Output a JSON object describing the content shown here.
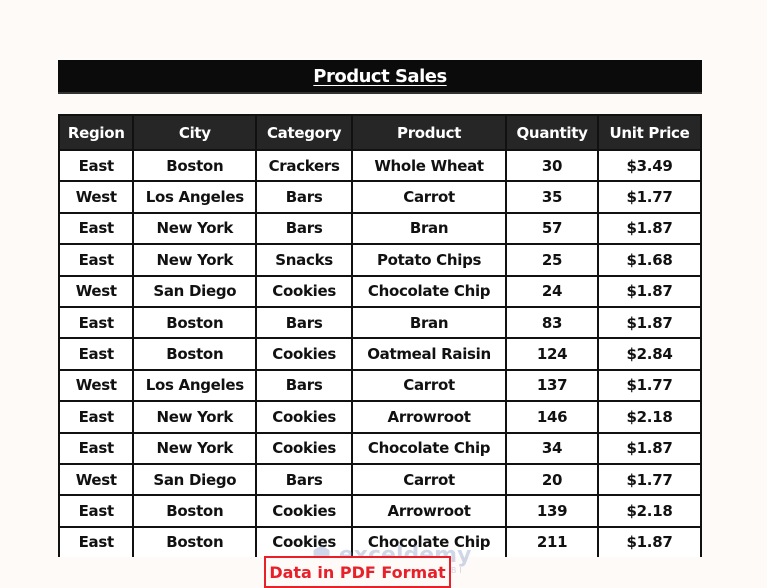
{
  "title": "Product Sales",
  "columns": [
    "Region",
    "City",
    "Category",
    "Product",
    "Quantity",
    "Unit Price"
  ],
  "rows": [
    [
      "East",
      "Boston",
      "Crackers",
      "Whole Wheat",
      "30",
      "$3.49"
    ],
    [
      "West",
      "Los Angeles",
      "Bars",
      "Carrot",
      "35",
      "$1.77"
    ],
    [
      "East",
      "New York",
      "Bars",
      "Bran",
      "57",
      "$1.87"
    ],
    [
      "East",
      "New York",
      "Snacks",
      "Potato Chips",
      "25",
      "$1.68"
    ],
    [
      "West",
      "San Diego",
      "Cookies",
      "Chocolate Chip",
      "24",
      "$1.87"
    ],
    [
      "East",
      "Boston",
      "Bars",
      "Bran",
      "83",
      "$1.87"
    ],
    [
      "East",
      "Boston",
      "Cookies",
      "Oatmeal Raisin",
      "124",
      "$2.84"
    ],
    [
      "West",
      "Los Angeles",
      "Bars",
      "Carrot",
      "137",
      "$1.77"
    ],
    [
      "East",
      "New York",
      "Cookies",
      "Arrowroot",
      "146",
      "$2.18"
    ],
    [
      "East",
      "New York",
      "Cookies",
      "Chocolate Chip",
      "34",
      "$1.87"
    ],
    [
      "West",
      "San Diego",
      "Bars",
      "Carrot",
      "20",
      "$1.77"
    ],
    [
      "East",
      "Boston",
      "Cookies",
      "Arrowroot",
      "139",
      "$2.18"
    ],
    [
      "East",
      "Boston",
      "Cookies",
      "Chocolate Chip",
      "211",
      "$1.87"
    ]
  ],
  "watermark": {
    "brand": "exceldemy",
    "tagline": "EXCEL · DATA · BI"
  },
  "caption": "Data in PDF Format",
  "colors": {
    "header_bg": "#262626",
    "caption": "#e8202a"
  }
}
